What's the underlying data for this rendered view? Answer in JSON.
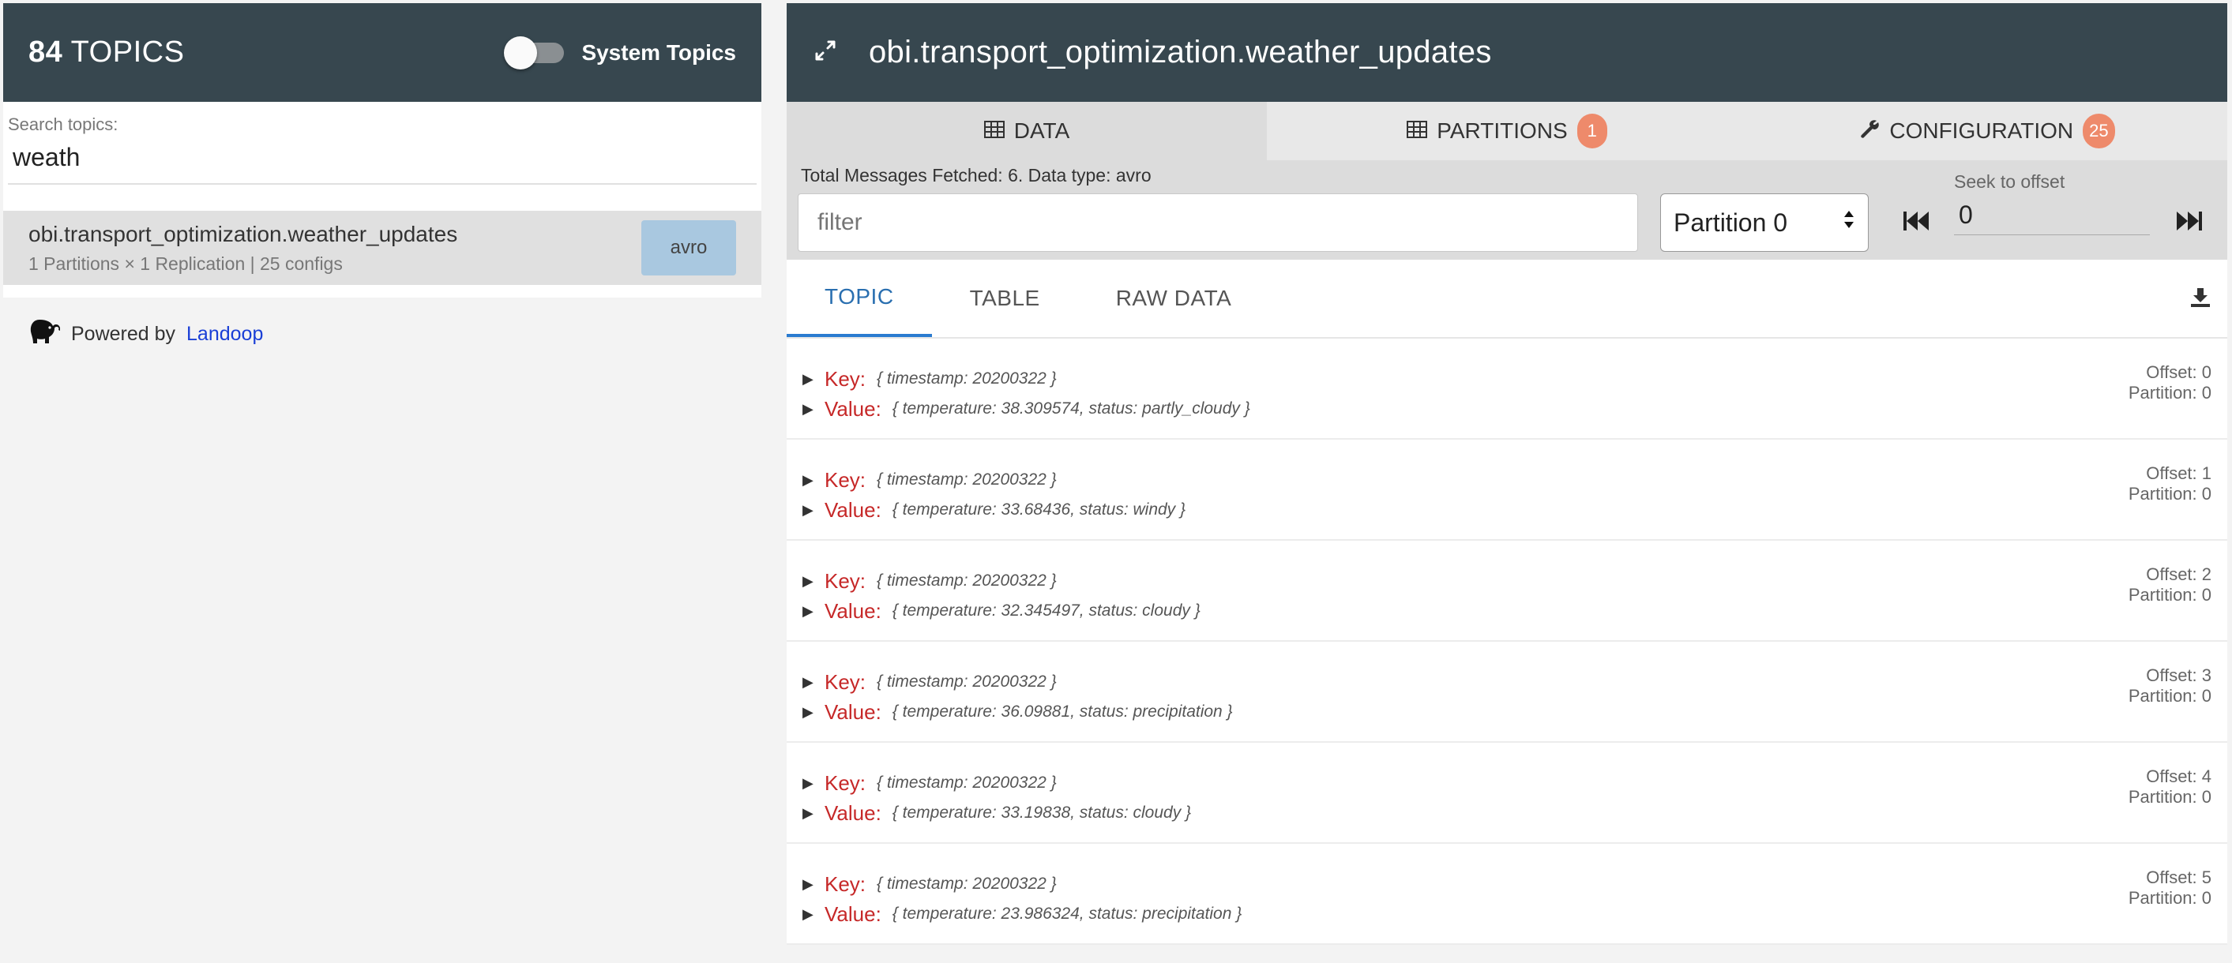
{
  "left": {
    "topic_count": "84",
    "topics_label": "TOPICS",
    "system_topics_label": "System Topics",
    "search_label": "Search topics:",
    "search_value": "weath",
    "topic": {
      "name": "obi.transport_optimization.weather_updates",
      "meta": "1 Partitions × 1 Replication | 25 configs",
      "format": "avro"
    },
    "powered_by": "Powered by",
    "powered_link": "Landoop"
  },
  "right": {
    "title": "obi.transport_optimization.weather_updates",
    "tabs": [
      {
        "label": "DATA"
      },
      {
        "label": "PARTITIONS",
        "badge": "1"
      },
      {
        "label": "CONFIGURATION",
        "badge": "25"
      }
    ],
    "fetched_text": "Total Messages Fetched: 6. Data type: avro",
    "filter_placeholder": "filter",
    "partition_selected": "Partition 0",
    "seek_label": "Seek to offset",
    "seek_value": "0",
    "view_tabs": [
      "TOPIC",
      "TABLE",
      "RAW DATA"
    ],
    "key_label": "Key:",
    "value_label": "Value:",
    "messages": [
      {
        "key": "{ timestamp: 20200322 }",
        "value": "{ temperature: 38.309574, status: partly_cloudy }",
        "offset": "Offset: 0",
        "partition": "Partition: 0"
      },
      {
        "key": "{ timestamp: 20200322 }",
        "value": "{ temperature: 33.68436, status: windy }",
        "offset": "Offset: 1",
        "partition": "Partition: 0"
      },
      {
        "key": "{ timestamp: 20200322 }",
        "value": "{ temperature: 32.345497, status: cloudy }",
        "offset": "Offset: 2",
        "partition": "Partition: 0"
      },
      {
        "key": "{ timestamp: 20200322 }",
        "value": "{ temperature: 36.09881, status: precipitation }",
        "offset": "Offset: 3",
        "partition": "Partition: 0"
      },
      {
        "key": "{ timestamp: 20200322 }",
        "value": "{ temperature: 33.19838, status: cloudy }",
        "offset": "Offset: 4",
        "partition": "Partition: 0"
      },
      {
        "key": "{ timestamp: 20200322 }",
        "value": "{ temperature: 23.986324, status: precipitation }",
        "offset": "Offset: 5",
        "partition": "Partition: 0"
      }
    ]
  },
  "colors": {
    "header_bg": "#37474f",
    "key_label": "#c62828",
    "badge": "#ee8a6b",
    "avro_badge": "#a9c8e0",
    "active_tab_underline": "#2a7bd0"
  }
}
